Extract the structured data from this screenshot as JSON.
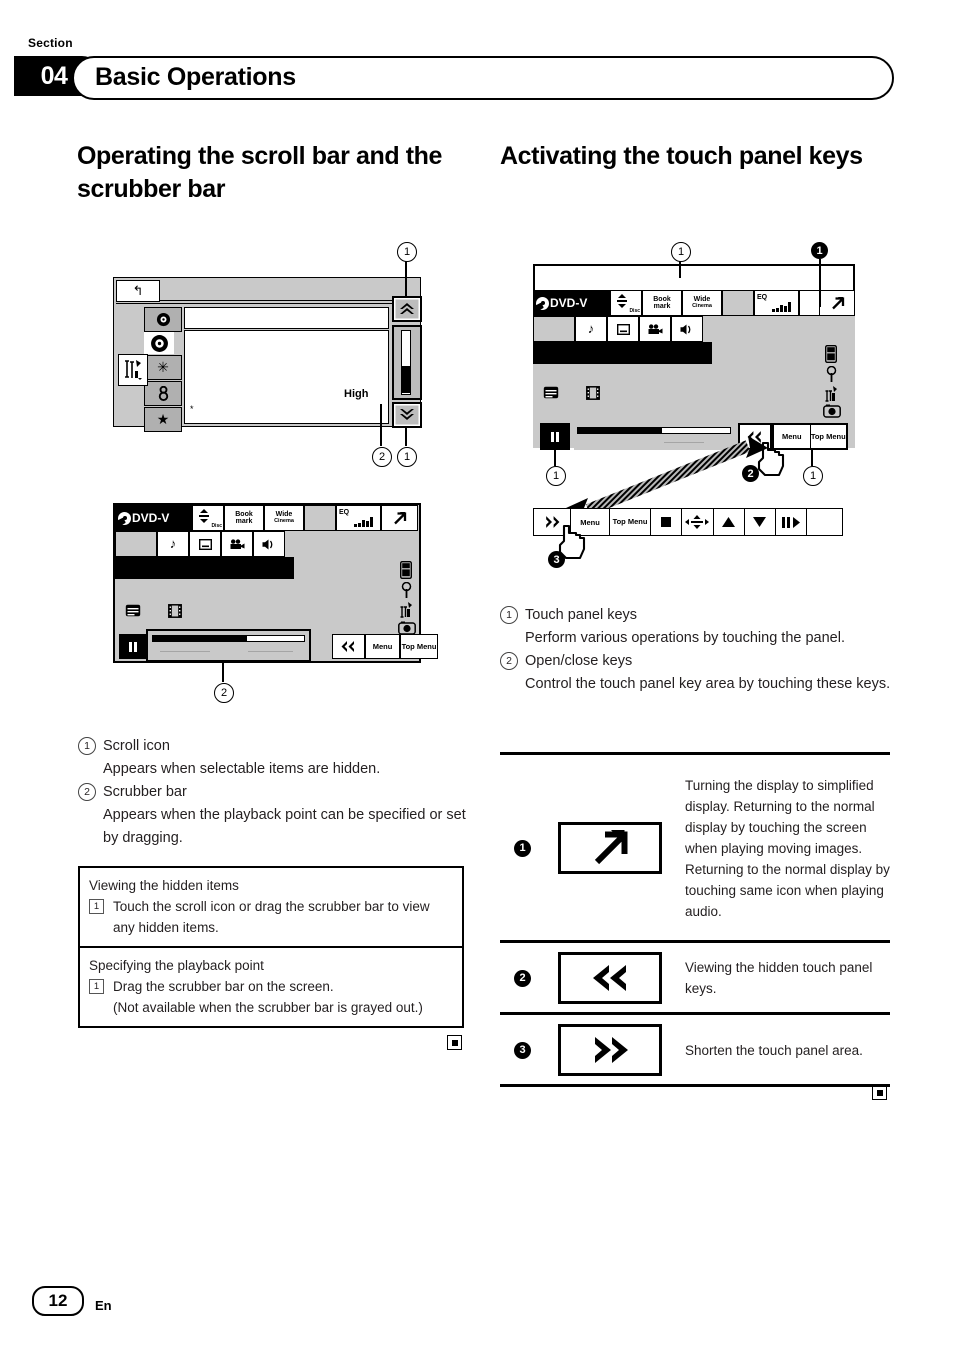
{
  "header": {
    "section_label": "Section",
    "section_number": "04",
    "section_title": "Basic Operations"
  },
  "headings": {
    "left": "Operating the scroll bar and the scrubber bar",
    "right": "Activating the touch panel keys"
  },
  "figure_scrollbar": {
    "callouts": [
      "1",
      "2",
      "1"
    ],
    "back_icon": "back-arrow-icon",
    "high_label": "High",
    "scroll_up_icon": "double-chevron-up-icon",
    "scroll_down_icon": "double-chevron-down-icon",
    "side_icons": [
      "disc-icon",
      "disc-small-icon",
      "asterisk-icon",
      "key-icon",
      "star-icon"
    ],
    "tools_icon": "tools-icon"
  },
  "figure_dvd_left": {
    "source_label": "DVD-V",
    "header_keys": [
      {
        "line1": "",
        "line2": "Disc",
        "icon": "updown-arrow-icon"
      },
      {
        "line1": "Book",
        "line2": "mark",
        "icon": ""
      },
      {
        "line1": "Wide",
        "line2": "Cinema",
        "icon": ""
      },
      {
        "line1": "",
        "line2": "",
        "icon": ""
      },
      {
        "line1": "EQ",
        "line2": "",
        "icon": "equalizer-bars-icon"
      },
      {
        "line1": "",
        "line2": "",
        "icon": ""
      },
      {
        "line1": "",
        "line2": "",
        "icon": "simplified-display-icon"
      }
    ],
    "second_row_icons": [
      "music-note-icon",
      "subtitle-icon",
      "camera-angle-icon",
      "audio-icon"
    ],
    "right_icons": [
      "phone-icon",
      "map-pin-icon",
      "tools-icon",
      "camera-icon"
    ],
    "content_icons": [
      "subtitle-panel-icon",
      "film-strip-icon"
    ],
    "bottom_keys": [
      "Menu",
      "Top Menu"
    ],
    "open_close_icon": "double-chevron-left-icon",
    "pause_icon": "pause-icon",
    "progress_percent": 62,
    "callout": "2"
  },
  "figure_dvd_right": {
    "source_label": "DVD-V",
    "header_keys": [
      {
        "line1": "",
        "line2": "Disc",
        "icon": "updown-arrow-icon"
      },
      {
        "line1": "Book",
        "line2": "mark",
        "icon": ""
      },
      {
        "line1": "Wide",
        "line2": "Cinema",
        "icon": ""
      },
      {
        "line1": "",
        "line2": "",
        "icon": ""
      },
      {
        "line1": "EQ",
        "line2": "",
        "icon": "equalizer-bars-icon"
      },
      {
        "line1": "",
        "line2": "",
        "icon": ""
      },
      {
        "line1": "",
        "line2": "",
        "icon": "simplified-display-icon"
      }
    ],
    "second_row_icons": [
      "music-note-icon",
      "subtitle-icon",
      "camera-angle-icon",
      "audio-icon"
    ],
    "right_icons": [
      "phone-icon",
      "map-pin-icon",
      "tools-icon",
      "camera-icon"
    ],
    "content_icons": [
      "subtitle-panel-icon",
      "film-strip-icon"
    ],
    "bottom_keys": [
      "Menu",
      "Top Menu"
    ],
    "open_close_icon": "double-chevron-left-icon",
    "pause_icon": "pause-icon",
    "progress_percent": 55,
    "callouts": [
      "1",
      "1",
      "1",
      "1"
    ],
    "filled_callouts": [
      "1",
      "2",
      "3"
    ],
    "expanded_bar": {
      "open_icon": "double-chevron-right-icon",
      "keys": [
        "Menu",
        "Top Menu",
        "stop-icon",
        "dpad-icon",
        "up-icon",
        "down-icon",
        "pause-step-icon",
        ""
      ]
    }
  },
  "left_list": [
    {
      "num": "1",
      "title": "Scroll icon",
      "body": "Appears when selectable items are hidden."
    },
    {
      "num": "2",
      "title": "Scrubber bar",
      "body": "Appears when the playback point can be specified or set by dragging."
    }
  ],
  "left_procedures": [
    {
      "title": "Viewing the hidden items",
      "step_number": "1",
      "step": "Touch the scroll icon or drag the scrubber bar to view any hidden items."
    },
    {
      "title": "Specifying the playback point",
      "step_number": "1",
      "step": "Drag the scrubber bar on the screen.",
      "note": "(Not available when the scrubber bar is grayed out.)"
    }
  ],
  "right_list": [
    {
      "num": "1",
      "title": "Touch panel keys",
      "body": "Perform various operations by touching the panel."
    },
    {
      "num": "2",
      "title": "Open/close keys",
      "body": "Control the touch panel key area by touching these keys."
    }
  ],
  "right_table": [
    {
      "num": "1",
      "icon": "simplified-display-icon",
      "desc": "Turning the display to simplified display. Returning to the normal display by touching the screen when playing moving images. Returning to the normal display by touching same icon when playing audio."
    },
    {
      "num": "2",
      "icon": "double-chevron-left-icon",
      "desc": "Viewing the hidden touch panel keys."
    },
    {
      "num": "3",
      "icon": "double-chevron-right-icon",
      "desc": "Shorten the touch panel area."
    }
  ],
  "footer": {
    "page_number": "12",
    "language": "En"
  },
  "colors": {
    "text": "#231f20",
    "screen_gray": "#c9c9c9",
    "key_gray": "#bdbdbd",
    "black": "#000000"
  }
}
